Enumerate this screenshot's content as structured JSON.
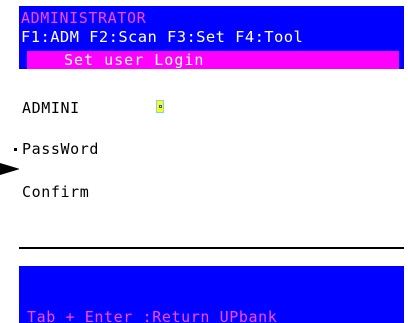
{
  "window": {
    "title": "ADMINISTRATOR"
  },
  "menu": {
    "items": [
      "F1:ADM",
      "F2:Scan",
      "F3:Set",
      "F4:Tool"
    ]
  },
  "dialog": {
    "header": "Set user Login",
    "fields": [
      {
        "label": "ADMINI"
      },
      {
        "label": "PassWord"
      },
      {
        "label": "Confirm"
      }
    ]
  },
  "footer": {
    "hint": "Tab + Enter :Return UPbank"
  },
  "colors": {
    "background": "#0000fe",
    "title": "#ff44ff",
    "header": "#ff00ff",
    "panel": "#ffffff",
    "cursor": "#ffff00"
  }
}
